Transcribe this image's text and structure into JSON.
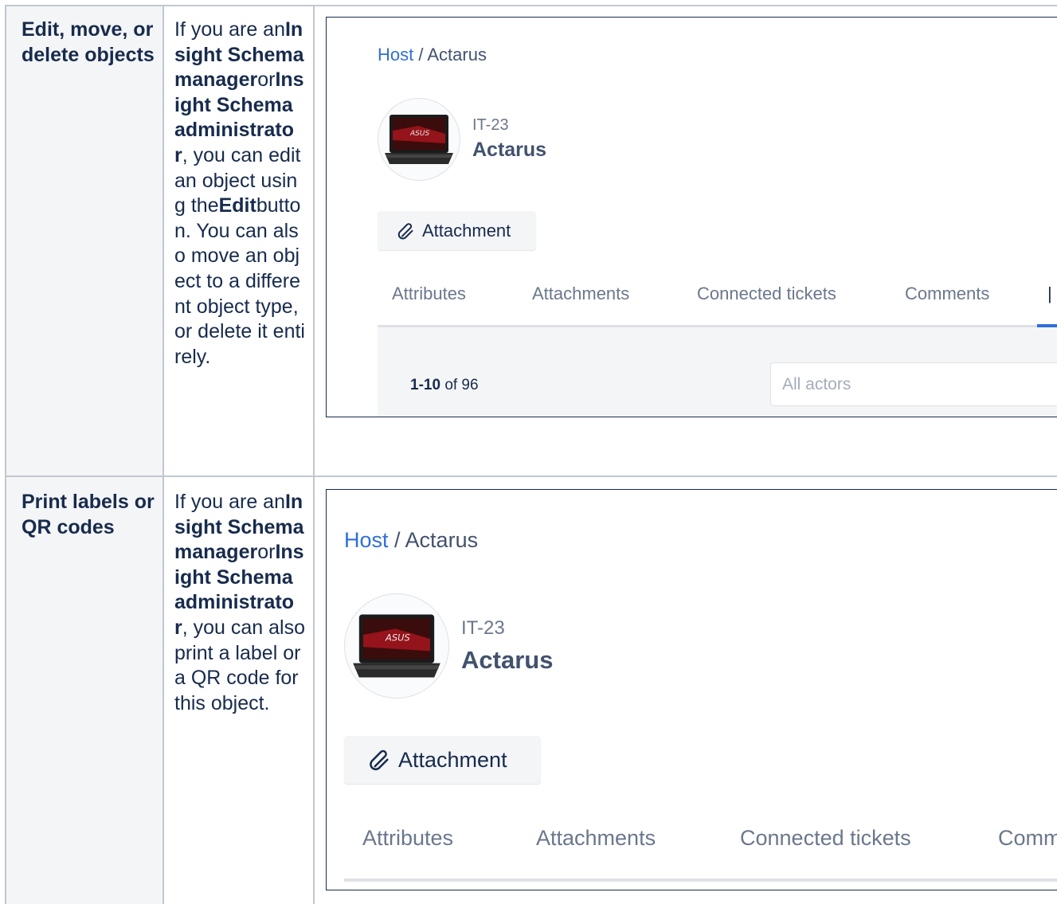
{
  "rows": [
    {
      "heading": "Edit, move, or delete objects",
      "desc": {
        "p1": "If you are an",
        "role1": "Insight Schema manager",
        "or": "or",
        "role2": "Insight Schema administrator",
        "p2": ", you can edit an object using the",
        "btn": "Edit",
        "p3": "button. You can also move an object to a different object type, or delete it entirely."
      }
    },
    {
      "heading": "Print labels or QR codes",
      "desc": {
        "p1": "If you are an",
        "role1": "Insight Schema manager",
        "or": "or",
        "role2": "Insight Schema administrator",
        "p2": ", you can also print a label or a QR code for this object."
      }
    }
  ],
  "screens": [
    {
      "breadcrumb": {
        "parent": "Host",
        "sep": " / ",
        "current": "Actarus"
      },
      "object": {
        "key": "IT-23",
        "name": "Actarus",
        "avatar_icon": "laptop-thumbnail"
      },
      "attach_button": {
        "label": "Attachment",
        "icon": "paperclip-icon"
      },
      "tabs": [
        "Attributes",
        "Attachments",
        "Connected tickets",
        "Comments"
      ],
      "pagination": {
        "range": "1-10",
        "of_text": "of 96"
      },
      "filter": {
        "placeholder": "All actors"
      }
    },
    {
      "breadcrumb": {
        "parent": "Host",
        "sep": " / ",
        "current": "Actarus"
      },
      "object": {
        "key": "IT-23",
        "name": "Actarus",
        "avatar_icon": "laptop-thumbnail"
      },
      "attach_button": {
        "label": "Attachment",
        "icon": "paperclip-icon"
      },
      "tabs": [
        "Attributes",
        "Attachments",
        "Connected tickets",
        "Comm"
      ]
    }
  ],
  "colors": {
    "link": "#2f6fd8",
    "text": "#172b4d",
    "muted": "#6b778c",
    "border": "#c1c7d0",
    "header_bg": "#f4f5f7"
  }
}
